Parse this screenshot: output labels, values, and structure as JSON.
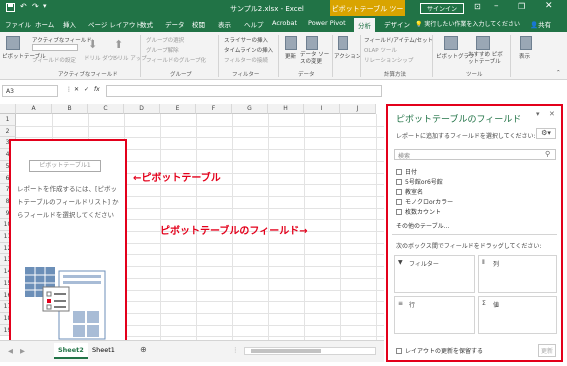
{
  "window": {
    "filename": "サンプル2.xlsx - Excel",
    "context_tool": "ピボットテーブル ツール",
    "signin": "サインイン"
  },
  "ribbon_tabs": [
    "ファイル",
    "ホーム",
    "挿入",
    "ページ レイアウト",
    "数式",
    "データ",
    "校閲",
    "表示",
    "ヘルプ",
    "Acrobat",
    "Power Pivot",
    "分析",
    "デザイン"
  ],
  "tell_me": "実行したい作業を入力してください",
  "share": "共有",
  "ribbon": {
    "pivot_table": "ピボットテーブル",
    "active_field_label": "アクティブなフィールド:",
    "field_settings": "フィールドの設定",
    "drill_down": "ドリル ダウン",
    "drill_up": "ドリル アップ",
    "group_select": "グループの選択",
    "ungroup": "グループ解除",
    "field_group": "フィールドのグループ化",
    "slicer": "スライサーの挿入",
    "timeline": "タイムラインの挿入",
    "filter_conn": "フィルターの接続",
    "refresh": "更新",
    "change_source": "データ ソースの変更",
    "actions": "アクション",
    "fields_items_sets": "フィールド/アイテム/セット",
    "olap_tools": "OLAP ツール",
    "relationships": "リレーションシップ",
    "pivot_chart": "ピボットグラフ",
    "recommended": "おすすめ ピボットテーブル",
    "show": "表示",
    "groups": [
      "アクティブなフィールド",
      "グループ",
      "フィルター",
      "データ",
      "計算方法",
      "ツール"
    ]
  },
  "formula_bar": {
    "namebox": "A3",
    "fx": "fx"
  },
  "sheet": {
    "columns": [
      "A",
      "B",
      "C",
      "D",
      "E",
      "F",
      "G",
      "H",
      "I",
      "J"
    ],
    "rows": [
      "1",
      "2",
      "3",
      "4",
      "5",
      "6",
      "7",
      "8",
      "9",
      "10",
      "11",
      "12",
      "13",
      "14",
      "15",
      "16",
      "17",
      "18",
      "19"
    ],
    "pivot_placeholder": "ピボットテーブル1",
    "pivot_instruction": "レポートを作成するには、[ピボットテーブルのフィールドリスト] からフィールドを選択してください",
    "annotation_pivot": "←ピボットテーブル",
    "annotation_fields": "ピボットテーブルのフィールド→"
  },
  "sheet_tabs": {
    "tabs": [
      "Sheet2",
      "Sheet1"
    ],
    "active": "Sheet2",
    "add": "⊕"
  },
  "pane": {
    "title": "ピボットテーブルのフィールド",
    "subtitle": "レポートに追加するフィールドを選択してください:",
    "search_placeholder": "検索",
    "fields": [
      "日付",
      "5号館or6号館",
      "教室名",
      "モノクロorカラー",
      "枚数カウント"
    ],
    "more_tables": "その他のテーブル...",
    "drag_text": "次のボックス間でフィールドをドラッグしてください:",
    "areas": {
      "filter": "フィルター",
      "columns": "列",
      "rows": "行",
      "values": "値"
    },
    "defer": "レイアウトの更新を保留する",
    "update": "更新"
  },
  "colors": {
    "excel_green": "#217346",
    "context_gold": "#d9a400",
    "annotation_red": "#e3001b"
  }
}
